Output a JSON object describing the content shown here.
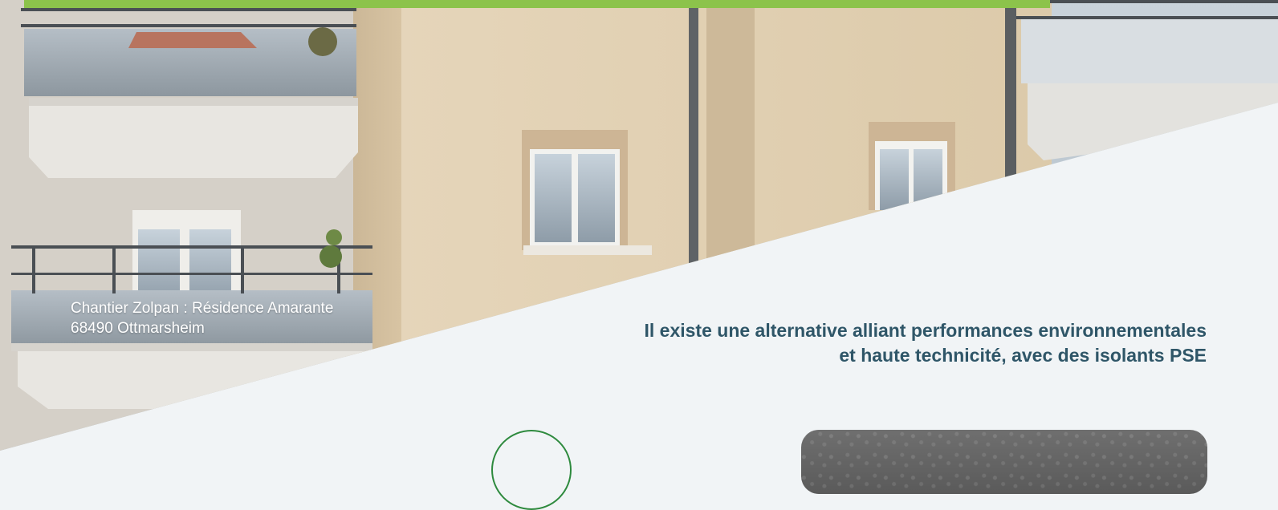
{
  "hero": {
    "image_alt": "Façade d'immeuble résidentiel avec balcons",
    "caption_line1": "Chantier Zolpan : Résidence Amarante",
    "caption_line2": "68490 Ottmarsheim"
  },
  "headline": {
    "line1": "Il existe une alternative alliant performances environnementales",
    "line2": "et haute technicité, avec des isolants PSE"
  },
  "colors": {
    "accent_green": "#8cc34b",
    "headline_blue": "#2f5668",
    "background": "#f1f4f6",
    "icon_ring_green": "#2e8a3e"
  },
  "icons": {
    "circle_icon": "eco-circle-icon"
  }
}
